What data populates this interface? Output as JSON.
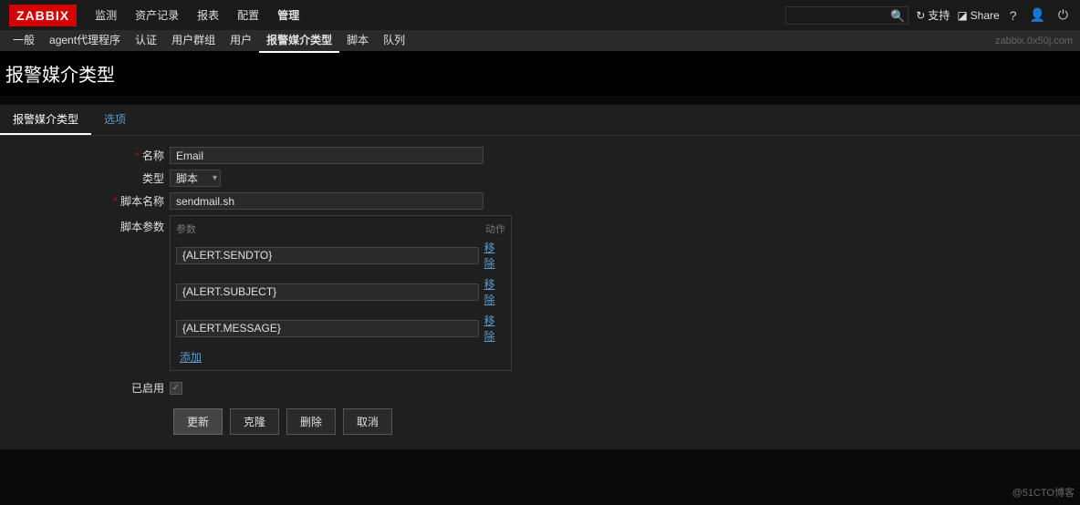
{
  "logo": "ZABBIX",
  "topnav": {
    "items": [
      "监测",
      "资产记录",
      "报表",
      "配置",
      "管理"
    ],
    "activeIndex": 4,
    "support": "支持",
    "share": "Share"
  },
  "subnav": {
    "items": [
      "一般",
      "agent代理程序",
      "认证",
      "用户群组",
      "用户",
      "报警媒介类型",
      "脚本",
      "队列"
    ],
    "activeIndex": 5,
    "breadcrumb": "zabbix.0x50j.com"
  },
  "pageTitle": "报警媒介类型",
  "tabs": [
    {
      "label": "报警媒介类型",
      "active": true
    },
    {
      "label": "选项",
      "active": false
    }
  ],
  "form": {
    "nameLabel": "名称",
    "nameValue": "Email",
    "typeLabel": "类型",
    "typeValue": "脚本",
    "scriptNameLabel": "脚本名称",
    "scriptNameValue": "sendmail.sh",
    "scriptParamsLabel": "脚本参数",
    "paramsHeader": {
      "param": "参数",
      "action": "动作"
    },
    "params": [
      {
        "value": "{ALERT.SENDTO}",
        "remove": "移除"
      },
      {
        "value": "{ALERT.SUBJECT}",
        "remove": "移除"
      },
      {
        "value": "{ALERT.MESSAGE}",
        "remove": "移除"
      }
    ],
    "addLink": "添加",
    "enabledLabel": "已启用",
    "enabledValue": true
  },
  "buttons": {
    "update": "更新",
    "clone": "克隆",
    "delete": "删除",
    "cancel": "取消"
  },
  "watermark": "@51CTO博客"
}
